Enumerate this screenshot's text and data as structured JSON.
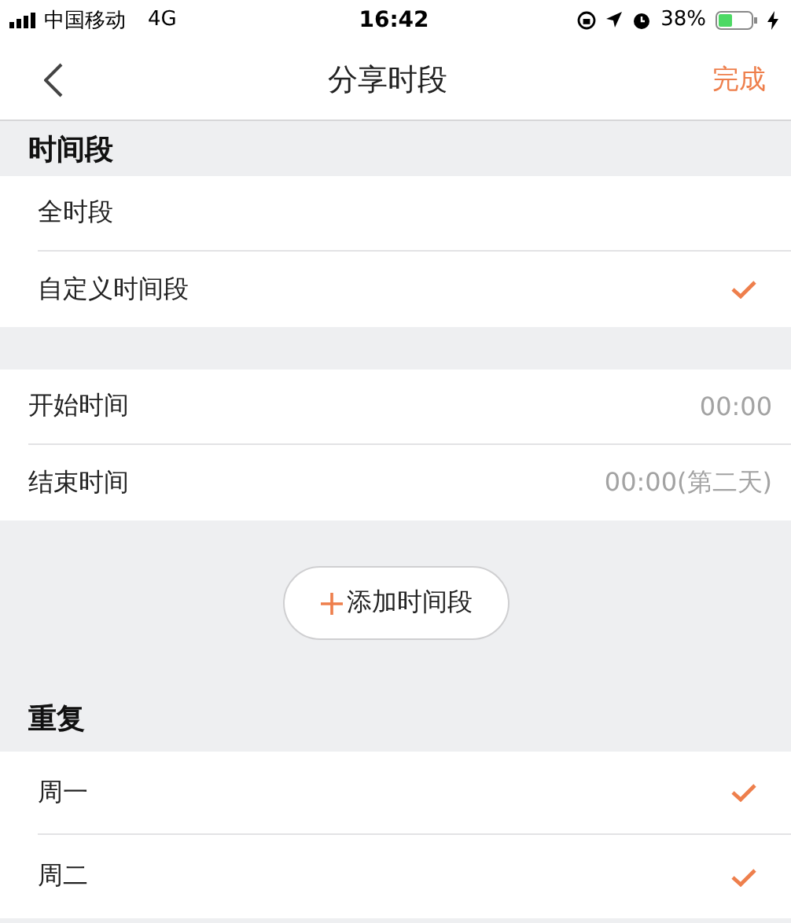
{
  "status_bar": {
    "carrier": "中国移动",
    "network": "4G",
    "time": "16:42",
    "battery": "38%"
  },
  "nav": {
    "title": "分享时段",
    "action": "完成"
  },
  "period": {
    "header": "时间段",
    "options": [
      {
        "label": "全时段",
        "selected": false
      },
      {
        "label": "自定义时间段",
        "selected": true
      }
    ]
  },
  "times": [
    {
      "label": "开始时间",
      "value": "00:00"
    },
    {
      "label": "结束时间",
      "value": "00:00(第二天)"
    }
  ],
  "add_button": "添加时间段",
  "repeat": {
    "header": "重复",
    "days": [
      {
        "label": "周一",
        "checked": true
      },
      {
        "label": "周二",
        "checked": true
      }
    ]
  }
}
